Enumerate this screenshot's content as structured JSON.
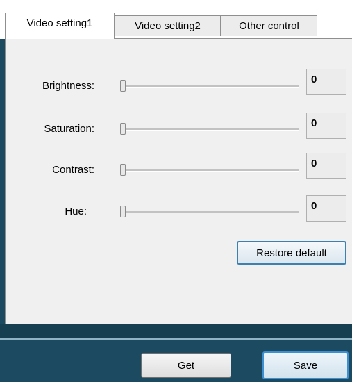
{
  "tabs": [
    {
      "label": "Video setting1",
      "active": true
    },
    {
      "label": "Video setting2",
      "active": false
    },
    {
      "label": "Other control",
      "active": false
    }
  ],
  "settings": [
    {
      "label": "Brightness:",
      "value": "0",
      "slider_fraction": 0
    },
    {
      "label": "Saturation:",
      "value": "0",
      "slider_fraction": 0
    },
    {
      "label": "Contrast:",
      "value": "0",
      "slider_fraction": 0
    },
    {
      "label": "Hue:",
      "value": "0",
      "slider_fraction": 0
    }
  ],
  "panel": {
    "restore_label": "Restore default"
  },
  "footer": {
    "get_label": "Get",
    "save_label": "Save"
  },
  "colors": {
    "frame": "#1c4a60",
    "panel": "#f0f0f0",
    "focus_accent": "#3c8fd0"
  }
}
